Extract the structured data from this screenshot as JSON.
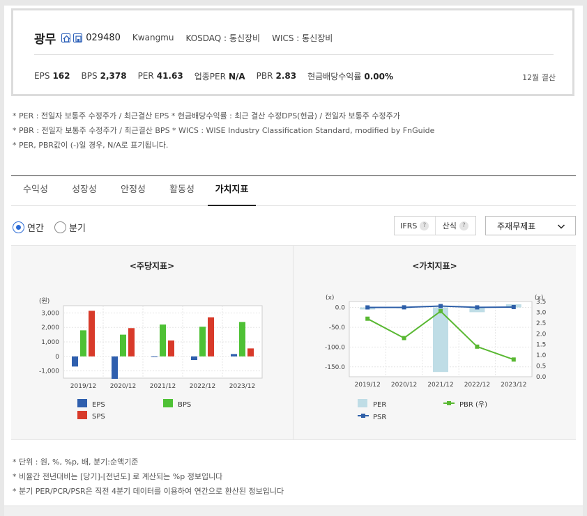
{
  "header": {
    "company": "광무",
    "code": "029480",
    "english_name": "Kwangmu",
    "market": "KOSDAQ : 통신장비",
    "wics": "WICS : 통신장비",
    "settlement": "12월 결산",
    "icons": [
      "home-icon",
      "building-icon"
    ]
  },
  "metrics": [
    {
      "label": "EPS",
      "value": "162"
    },
    {
      "label": "BPS",
      "value": "2,378"
    },
    {
      "label": "PER",
      "value": "41.63"
    },
    {
      "label": "업종PER",
      "value": "N/A"
    },
    {
      "label": "PBR",
      "value": "2.83"
    },
    {
      "label": "현금배당수익률",
      "value": "0.00%"
    }
  ],
  "notes_top": [
    "* PER : 전일자 보통주 수정주가 / 최근결산 EPS * 현금배당수익률 : 최근 결산 수정DPS(현금) / 전일자 보통주 수정주가",
    "* PBR : 전일자 보통주 수정주가 / 최근결산 BPS * WICS : WISE Industry Classification Standard, modified by FnGuide",
    "* PER, PBR값이 (-)일 경우, N/A로 표기됩니다."
  ],
  "tabs": [
    {
      "label": "수익성",
      "active": false
    },
    {
      "label": "성장성",
      "active": false
    },
    {
      "label": "안정성",
      "active": false
    },
    {
      "label": "활동성",
      "active": false
    },
    {
      "label": "가치지표",
      "active": true
    }
  ],
  "options": {
    "radio_annual": "연간",
    "radio_quarter": "분기",
    "selected": "연간",
    "toggle_ifrs": "IFRS",
    "toggle_calc": "산식",
    "help_glyph": "?",
    "select_value": "주재무제표"
  },
  "colors": {
    "eps": "#2f5fae",
    "bps": "#4ec135",
    "sps": "#d83a2a",
    "per": "#bfdde6",
    "pbr": "#59b832",
    "psr": "#2e5fa8"
  },
  "chart_data": [
    {
      "type": "bar",
      "title": "<주당지표>",
      "unit_label": "(원)",
      "categories": [
        "2019/12",
        "2020/12",
        "2021/12",
        "2022/12",
        "2023/12"
      ],
      "ylim": [
        -1500,
        3500
      ],
      "yticks": [
        -1000,
        0,
        1000,
        2000,
        3000
      ],
      "ytick_labels": [
        "-1,000",
        "0",
        "1,000",
        "2,000",
        "3,000"
      ],
      "grid": true,
      "legend_position": "bottom",
      "series": [
        {
          "name": "EPS",
          "values": [
            -700,
            -1550,
            -30,
            -250,
            162
          ]
        },
        {
          "name": "BPS",
          "values": [
            1800,
            1500,
            2200,
            2050,
            2378
          ]
        },
        {
          "name": "SPS",
          "values": [
            3150,
            1950,
            1100,
            2700,
            550
          ]
        }
      ]
    },
    {
      "type": "bar+line",
      "title": "<가치지표>",
      "left_unit_label": "(x)",
      "right_unit_label": "(x)",
      "categories": [
        "2019/12",
        "2020/12",
        "2021/12",
        "2022/12",
        "2023/12"
      ],
      "left_ylim": [
        -175,
        15
      ],
      "left_yticks": [
        0,
        -50,
        -100,
        -150
      ],
      "left_ytick_labels": [
        "0.0",
        "-50.0",
        "-100.0",
        "-150.0"
      ],
      "right_ylim": [
        0,
        3.5
      ],
      "right_yticks": [
        0,
        0.5,
        1.0,
        1.5,
        2.0,
        2.5,
        3.0,
        3.5
      ],
      "right_ytick_labels": [
        "0.0",
        "0.5",
        "1.0",
        "1.5",
        "2.0",
        "2.5",
        "3.0",
        "3.5"
      ],
      "grid": true,
      "legend_position": "bottom",
      "series": [
        {
          "name": "PER",
          "kind": "bar",
          "axis": "left",
          "values": [
            -5,
            -2,
            -163,
            -12,
            8
          ]
        },
        {
          "name": "PBR (우)",
          "kind": "line",
          "axis": "right",
          "values": [
            2.7,
            1.8,
            3.05,
            1.4,
            0.8
          ]
        },
        {
          "name": "PSR",
          "kind": "line",
          "axis": "left",
          "values": [
            0.1,
            0.3,
            3.5,
            0.2,
            1.0
          ]
        }
      ]
    }
  ],
  "notes_bottom": [
    "* 단위 : 원, %, %p, 배, 분기:순액기준",
    "* 비율간 전년대비는 [당기]-[전년도] 로 계산되는 %p 정보입니다",
    "* 분기 PER/PCR/PSR은 직전 4분기 데이터를 이용하여 연간으로 환산된 정보입니다"
  ]
}
